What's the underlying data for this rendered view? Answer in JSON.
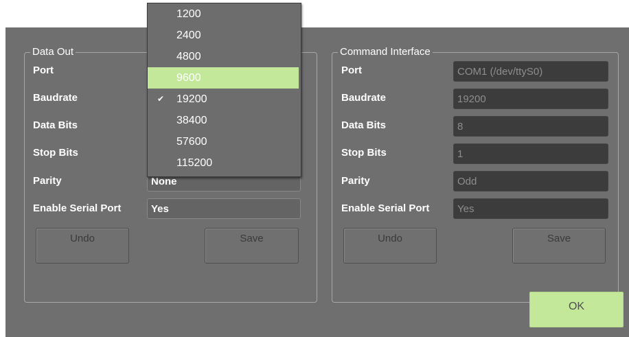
{
  "data_out": {
    "title": "Data Out",
    "labels": [
      "Port",
      "Baudrate",
      "Data Bits",
      "Stop Bits",
      "Parity",
      "Enable Serial Port"
    ],
    "parity_value": "None",
    "enable_value": "Yes",
    "undo_label": "Undo",
    "save_label": "Save"
  },
  "command_interface": {
    "title": "Command Interface",
    "labels": [
      "Port",
      "Baudrate",
      "Data Bits",
      "Stop Bits",
      "Parity",
      "Enable Serial Port"
    ],
    "values": [
      "COM1 (/dev/ttyS0)",
      "19200",
      "8",
      "1",
      "Odd",
      "Yes"
    ],
    "undo_label": "Undo",
    "save_label": "Save"
  },
  "baudrate_dropdown": {
    "options": [
      "1200",
      "2400",
      "4800",
      "9600",
      "19200",
      "38400",
      "57600",
      "115200"
    ],
    "highlighted": "9600",
    "checked": "19200",
    "check_glyph": "✔"
  },
  "ok_label": "OK",
  "colors": {
    "dialog_bg": "#6f6f6f",
    "accent_green": "#c4e89a",
    "readonly_field": "#3c3c3c"
  }
}
